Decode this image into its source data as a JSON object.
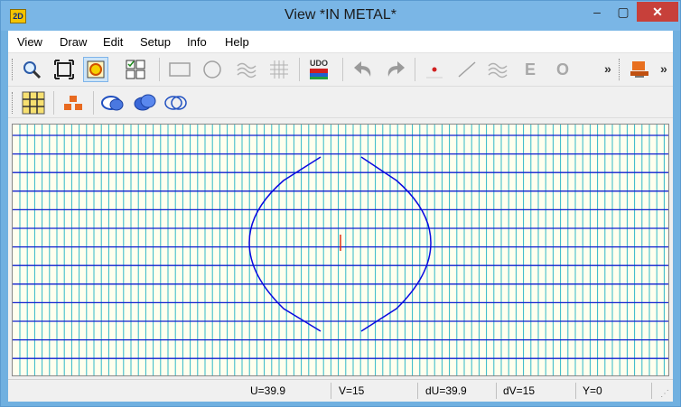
{
  "window": {
    "app_icon": "2D",
    "title": "View   *IN METAL*",
    "min": "–",
    "max": "▢",
    "close": "✕"
  },
  "menu": [
    "View",
    "Draw",
    "Edit",
    "Setup",
    "Info",
    "Help"
  ],
  "toolbar1": {
    "chevron1": "»",
    "chevron2": "»",
    "udo": "UDO",
    "e_label": "E",
    "o_label": "O"
  },
  "status": {
    "u": "U=39.9",
    "v": "V=15",
    "du": "dU=39.9",
    "dv": "dV=15",
    "y": "Y=0"
  },
  "colors": {
    "grid_major": "#1020d0",
    "grid_minor": "#30b8c8",
    "shape": "#0a0ae0",
    "marker": "#e03010",
    "canvas_bg": "#ffffee"
  },
  "icons": {
    "zoom": "magnifier-icon",
    "fit": "fit-extents-icon",
    "view_active": "view-target-icon",
    "layers": "layers-grid-icon",
    "rectangle": "rectangle-icon",
    "circle": "circle-icon",
    "wave": "wave-icon",
    "hatch": "hatch-grid-icon",
    "udo": "udo-book-icon",
    "undo": "undo-icon",
    "redo": "redo-icon",
    "point": "point-icon",
    "line": "line-icon",
    "wave2": "wave-icon",
    "e": "e-letter-icon",
    "o": "o-letter-icon",
    "user": "user-computer-icon",
    "grid": "grid-select-icon",
    "stack": "stack-blocks-icon",
    "shape1": "shape-one-icon",
    "shape2": "shape-two-icon",
    "shape3": "shape-three-icon"
  }
}
